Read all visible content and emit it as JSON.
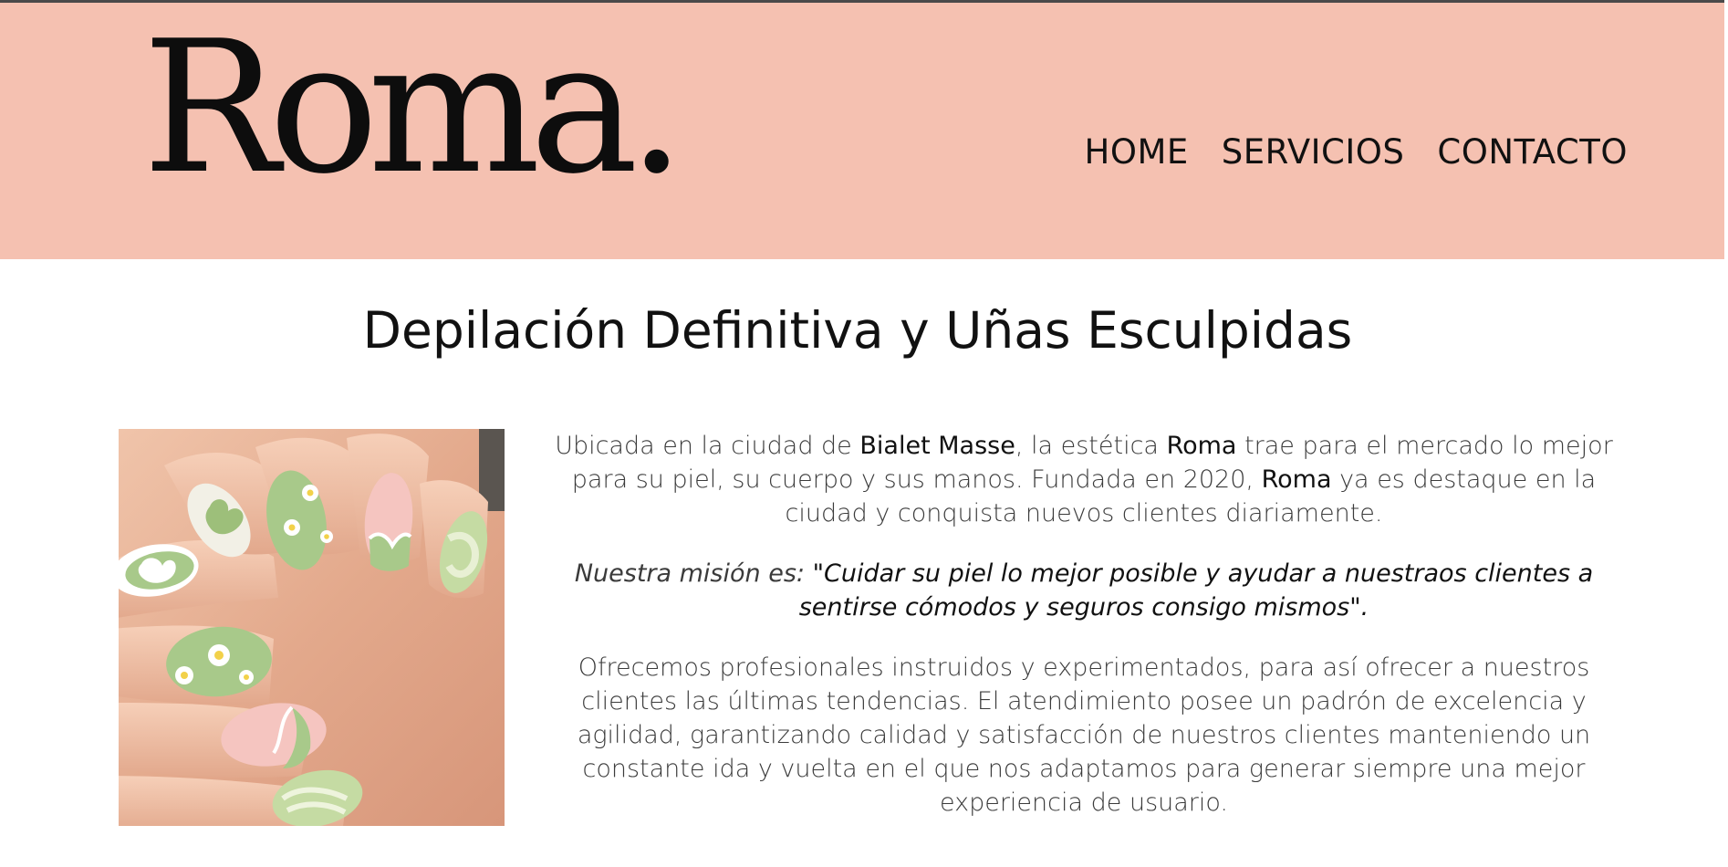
{
  "header": {
    "logo": "Roma.",
    "background_color": "#f5c1b1",
    "nav": [
      {
        "label": "HOME"
      },
      {
        "label": "SERVICIOS"
      },
      {
        "label": "CONTACTO"
      }
    ]
  },
  "main": {
    "title": "Depilación Definitiva y Uñas Esculpidas",
    "image_alt": "Uñas esculpidas verdes con corazones y flores",
    "intro": {
      "part1": "Ubicada en la ciudad de ",
      "city": "Bialet Masse",
      "part2": ", la estética ",
      "brand1": "Roma",
      "part3": " trae para el mercado lo mejor para su piel, su cuerpo y sus manos. Fundada en 2020, ",
      "brand2": "Roma",
      "part4": " ya es destaque en la ciudad y conquista nuevos clientes diariamente."
    },
    "mission": {
      "label": "Nuestra misión es: ",
      "quote": "\"Cuidar su piel lo mejor posible y ayudar a nuestraos clientes a sentirse cómodos y seguros consigo mismos\"."
    },
    "offer": "Ofrecemos profesionales instruidos y experimentados, para así ofrecer a nuestros clientes las últimas tendencias. El atendimiento posee un padrón de excelencia y agilidad, garantizando calidad y satisfacción de nuestros clientes manteniendo un constante ida y vuelta en el que nos adaptamos para generar siempre una mejor experiencia de usuario."
  }
}
